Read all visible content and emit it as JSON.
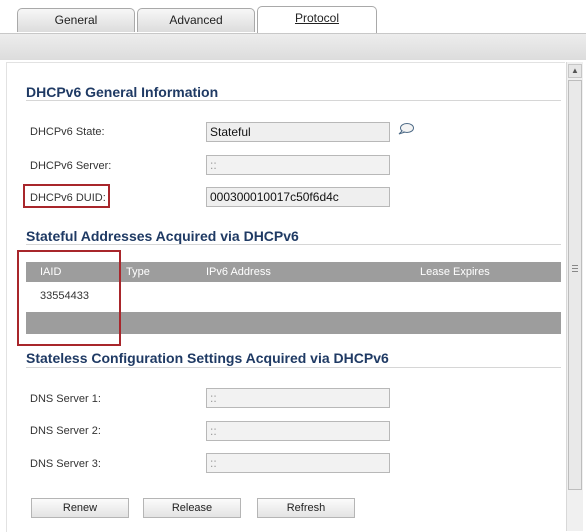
{
  "tabs": [
    {
      "label": "General"
    },
    {
      "label": "Advanced"
    },
    {
      "label": "Protocol",
      "active": true
    }
  ],
  "general_info": {
    "title": "DHCPv6 General Information",
    "state_label": "DHCPv6 State:",
    "state_value": "Stateful",
    "server_label": "DHCPv6 Server:",
    "server_value": "::",
    "duid_label": "DHCPv6 DUID:",
    "duid_value": "000300010017c50f6d4c"
  },
  "stateful": {
    "title": "Stateful Addresses Acquired via DHCPv6",
    "columns": [
      "IAID",
      "Type",
      "IPv6 Address",
      "Lease Expires"
    ],
    "rows": [
      {
        "iaid": "33554433"
      }
    ]
  },
  "stateless": {
    "title": "Stateless Configuration Settings Acquired via DHCPv6",
    "dns1_label": "DNS Server 1:",
    "dns1_value": "::",
    "dns2_label": "DNS Server 2:",
    "dns2_value": "::",
    "dns3_label": "DNS Server 3:",
    "dns3_value": "::"
  },
  "buttons": {
    "renew": "Renew",
    "release": "Release",
    "refresh": "Refresh"
  },
  "icons": {
    "comment": "comment-bubble-icon",
    "scroll_up": "scroll-up-arrow-icon"
  },
  "colors": {
    "heading": "#1f3a64",
    "highlight_box": "#a8262b",
    "table_header": "#9d9d9d"
  }
}
